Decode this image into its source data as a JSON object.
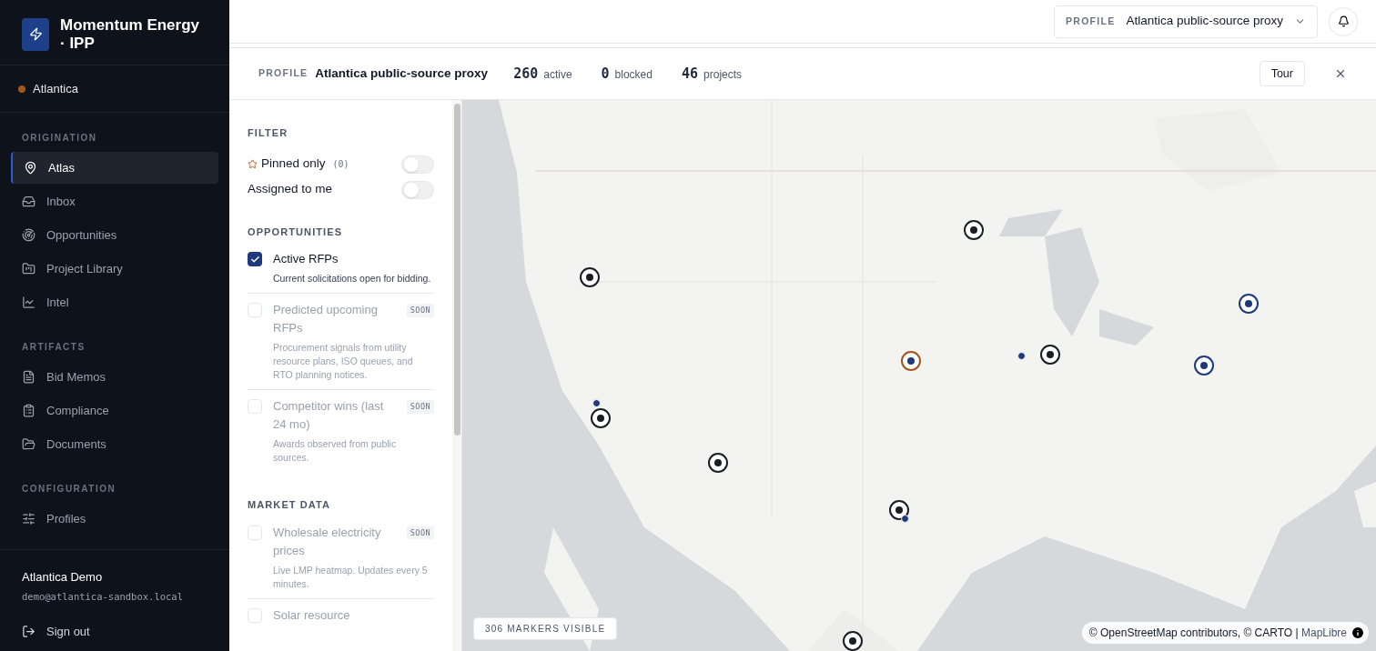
{
  "brand": {
    "name": "Momentum Energy · IPP"
  },
  "workspace": {
    "name": "Atlantica",
    "color": "#a0561c"
  },
  "nav_sections": [
    {
      "title": "ORIGINATION",
      "items": [
        {
          "label": "Atlas",
          "selected": true
        },
        {
          "label": "Inbox",
          "selected": false
        },
        {
          "label": "Opportunities",
          "selected": false
        },
        {
          "label": "Project Library",
          "selected": false
        },
        {
          "label": "Intel",
          "selected": false
        }
      ]
    },
    {
      "title": "ARTIFACTS",
      "items": [
        {
          "label": "Bid Memos",
          "selected": false
        },
        {
          "label": "Compliance",
          "selected": false
        },
        {
          "label": "Documents",
          "selected": false
        }
      ]
    },
    {
      "title": "CONFIGURATION",
      "items": [
        {
          "label": "Profiles",
          "selected": false
        }
      ]
    }
  ],
  "user": {
    "name": "Atlantica Demo",
    "email": "demo@atlantica-sandbox.local",
    "sign_out": "Sign out"
  },
  "topbar": {
    "profile_label": "PROFILE",
    "profile_value": "Atlantica public-source proxy"
  },
  "profile_bar": {
    "label": "PROFILE",
    "name": "Atlantica public-source proxy",
    "stats": [
      {
        "value": "260",
        "label": "active"
      },
      {
        "value": "0",
        "label": "blocked"
      },
      {
        "value": "46",
        "label": "projects"
      }
    ],
    "tour": "Tour"
  },
  "filter": {
    "title": "FILTER",
    "toggles": [
      {
        "label": "Pinned only",
        "count": "(0)",
        "starred": true,
        "on": false
      },
      {
        "label": "Assigned to me",
        "starred": false,
        "on": false
      }
    ]
  },
  "groups": [
    {
      "title": "OPPORTUNITIES",
      "items": [
        {
          "label": "Active RFPs",
          "description": "Current solicitations open for bidding.",
          "checked": true,
          "disabled": false
        },
        {
          "label": "Predicted upcoming RFPs",
          "description": "Procurement signals from utility resource plans, ISO queues, and RTO planning notices.",
          "checked": false,
          "disabled": true,
          "badge": "SOON"
        },
        {
          "label": "Competitor wins (last 24 mo)",
          "description": "Awards observed from public sources.",
          "checked": false,
          "disabled": true,
          "badge": "SOON"
        }
      ]
    },
    {
      "title": "MARKET DATA",
      "items": [
        {
          "label": "Wholesale electricity prices",
          "description": "Live LMP heatmap. Updates every 5 minutes.",
          "checked": false,
          "disabled": true,
          "badge": "SOON"
        },
        {
          "label": "Solar resource",
          "checked": false,
          "disabled": true
        }
      ]
    }
  ],
  "map": {
    "kind": "picture",
    "markers_count": "306 MARKERS VISIBLE",
    "attribution": "© OpenStreetMap contributors, © CARTO | ",
    "attribution_link": "MapLibre",
    "markers": [
      {
        "kind": "ring"
      },
      {
        "kind": "ring"
      },
      {
        "kind": "ring",
        "color": "#1e3a7b"
      },
      {
        "kind": "dot"
      },
      {
        "kind": "ring"
      },
      {
        "kind": "ring",
        "color": "#a0561c"
      },
      {
        "kind": "ring",
        "color": "#1e3a7b"
      },
      {
        "kind": "dot"
      },
      {
        "kind": "ring"
      },
      {
        "kind": "ring"
      },
      {
        "kind": "ring"
      },
      {
        "kind": "dot"
      },
      {
        "kind": "ring"
      }
    ]
  }
}
